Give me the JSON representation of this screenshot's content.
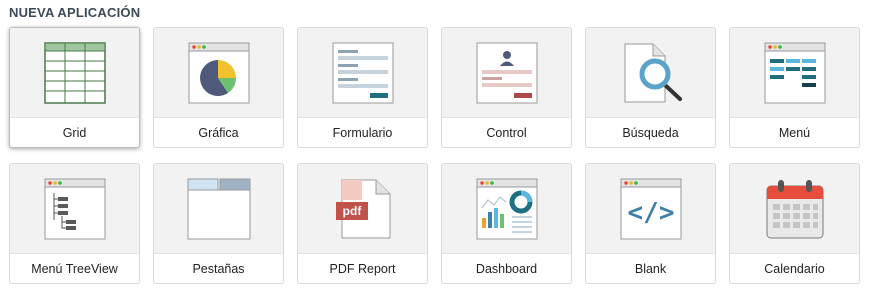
{
  "header": {
    "title": "NUEVA APLICACIÓN"
  },
  "cards": [
    {
      "label": "Grid",
      "icon": "grid-icon"
    },
    {
      "label": "Gráfica",
      "icon": "chart-icon"
    },
    {
      "label": "Formulario",
      "icon": "form-icon"
    },
    {
      "label": "Control",
      "icon": "control-icon"
    },
    {
      "label": "Búsqueda",
      "icon": "search-icon"
    },
    {
      "label": "Menú",
      "icon": "menu-icon"
    },
    {
      "label": "Menú TreeView",
      "icon": "treeview-icon"
    },
    {
      "label": "Pestañas",
      "icon": "tabs-icon"
    },
    {
      "label": "PDF Report",
      "icon": "pdf-icon",
      "badge": "pdf"
    },
    {
      "label": "Dashboard",
      "icon": "dashboard-icon"
    },
    {
      "label": "Blank",
      "icon": "code-icon",
      "glyph": "</>"
    },
    {
      "label": "Calendario",
      "icon": "calendar-icon"
    }
  ],
  "colors": {
    "grid_green": "#4a7a4a",
    "pie_navy": "#4f5a7a",
    "pie_yellow": "#f2c12e",
    "pie_green": "#6cc070",
    "teal": "#1f6f80",
    "light_blue": "#5bb7e0",
    "red_dot": "#e8483b",
    "yellow_dot": "#f0b429",
    "green_dot": "#3cb54a",
    "calendar_red": "#e74c3c",
    "pdf_red": "#c0524a",
    "code_blue": "#3d7fa6"
  }
}
